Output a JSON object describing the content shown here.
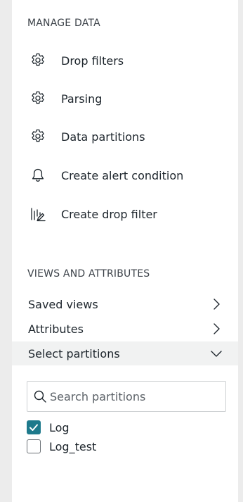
{
  "manage_data": {
    "title": "MANAGE DATA",
    "items": [
      {
        "label": "Drop filters",
        "icon": "gear-icon"
      },
      {
        "label": "Parsing",
        "icon": "gear-icon"
      },
      {
        "label": "Data partitions",
        "icon": "gear-icon"
      },
      {
        "label": "Create alert condition",
        "icon": "bell-icon"
      },
      {
        "label": "Create drop filter",
        "icon": "drop-filter-icon"
      }
    ]
  },
  "views": {
    "title": "VIEWS AND ATTRIBUTES",
    "items": [
      {
        "label": "Saved views",
        "icon": "chevron-right-icon"
      },
      {
        "label": "Attributes",
        "icon": "chevron-right-icon"
      },
      {
        "label": "Select partitions",
        "icon": "chevron-down-icon",
        "expanded": true
      }
    ]
  },
  "partitions": {
    "search_placeholder": "Search partitions",
    "options": [
      {
        "label": "Log",
        "checked": true
      },
      {
        "label": "Log_test",
        "checked": false
      }
    ]
  },
  "colors": {
    "accent": "#1e7a8c",
    "active_row": "#f1f2f2",
    "background": "#ececec"
  }
}
